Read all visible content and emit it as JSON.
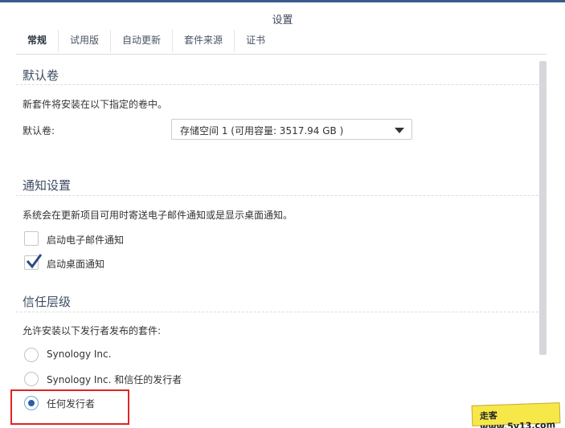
{
  "window": {
    "title": "设置"
  },
  "tabs": [
    {
      "label": "常规"
    },
    {
      "label": "试用版"
    },
    {
      "label": "自动更新"
    },
    {
      "label": "套件来源"
    },
    {
      "label": "证书"
    }
  ],
  "default_volume": {
    "heading": "默认卷",
    "description": "新套件将安装在以下指定的卷中。",
    "field_label": "默认卷:",
    "selected_value": "存储空间 1 (可用容量:  3517.94 GB )"
  },
  "notifications": {
    "heading": "通知设置",
    "description": "系统会在更新项目可用时寄送电子邮件通知或是显示桌面通知。",
    "options": [
      {
        "label": "启动电子邮件通知",
        "checked": false
      },
      {
        "label": "启动桌面通知",
        "checked": true
      }
    ]
  },
  "trust_level": {
    "heading": "信任层级",
    "description": "允许安装以下发行者发布的套件:",
    "options": [
      {
        "label": "Synology Inc.",
        "selected": false
      },
      {
        "label": "Synology Inc. 和信任的发行者",
        "selected": false
      },
      {
        "label": "任何发行者",
        "selected": true
      }
    ]
  },
  "watermark": {
    "text": "走客 www.5v13.com"
  }
}
